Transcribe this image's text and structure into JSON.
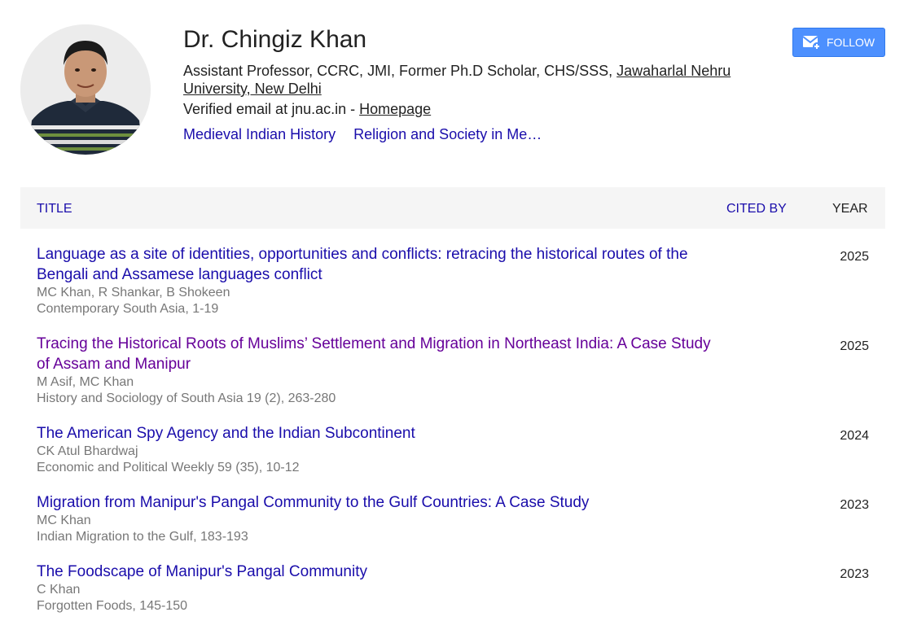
{
  "profile": {
    "name": "Dr. Chingiz Khan",
    "affiliation_text": "Assistant Professor, CCRC, JMI, Former Ph.D Scholar, CHS/SSS, ",
    "affiliation_link": "Jawaharlal Nehru University, New Delhi",
    "email_text": "Verified email at jnu.ac.in - ",
    "homepage_label": "Homepage",
    "interests": [
      "Medieval Indian History",
      "Religion and Society in Me…"
    ]
  },
  "follow_button": {
    "label": "FOLLOW",
    "icon": "mail-plus-icon",
    "color": "#4d90fe"
  },
  "table": {
    "headers": {
      "title": "TITLE",
      "cited_by": "CITED BY",
      "year": "YEAR"
    },
    "rows": [
      {
        "title": "Language as a site of identities, opportunities and conflicts: retracing the historical routes of the Bengali and Assamese languages conflict",
        "authors": "MC Khan, R Shankar, B Shokeen",
        "venue": "Contemporary South Asia, 1-19",
        "cited_by": "",
        "year": "2025"
      },
      {
        "title": "Tracing the Historical Roots of Muslims’ Settlement and Migration in Northeast India: A Case Study of Assam and Manipur",
        "authors": "M Asif, MC Khan",
        "venue": "History and Sociology of South Asia 19 (2), 263-280",
        "cited_by": "",
        "year": "2025"
      },
      {
        "title": "The American Spy Agency and the Indian Subcontinent",
        "authors": "CK Atul Bhardwaj",
        "venue": "Economic and Political Weekly 59 (35), 10-12",
        "cited_by": "",
        "year": "2024"
      },
      {
        "title": "Migration from Manipur's Pangal Community to the Gulf Countries: A Case Study",
        "authors": "MC Khan",
        "venue": "Indian Migration to the Gulf, 183-193",
        "cited_by": "",
        "year": "2023"
      },
      {
        "title": "The Foodscape of Manipur's Pangal Community",
        "authors": "C Khan",
        "venue": "Forgotten Foods, 145-150",
        "cited_by": "",
        "year": "2023"
      }
    ]
  },
  "colors": {
    "link": "#1a0dab",
    "visited_link": "#660099",
    "meta_text": "#777777",
    "header_bg": "#f5f5f5"
  }
}
